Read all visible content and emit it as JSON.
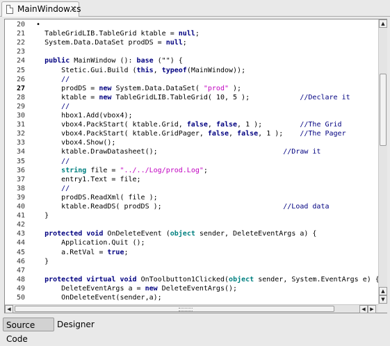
{
  "window": {
    "tab_title": "MainWindow.cs",
    "close_glyph": "✕",
    "icons": [
      "document-icon",
      "close-icon"
    ]
  },
  "editor": {
    "line_numbers": [
      "20",
      "21",
      "22",
      "23",
      "24",
      "25",
      "26",
      "27",
      "28",
      "29",
      "30",
      "31",
      "32",
      "33",
      "34",
      "35",
      "36",
      "37",
      "38",
      "39",
      "40",
      "41",
      "42",
      "43",
      "44",
      "45",
      "46",
      "47",
      "48",
      "49",
      "50"
    ],
    "current_line": "27",
    "lines": [
      [
        [
          "t",
          "  •"
        ]
      ],
      [
        [
          "t",
          "    TableGridLIB.TableGrid ktable = "
        ],
        [
          "k",
          "null"
        ],
        [
          "t",
          ";"
        ]
      ],
      [
        [
          "t",
          "    System.Data.DataSet prodDS = "
        ],
        [
          "k",
          "null"
        ],
        [
          "t",
          ";"
        ]
      ],
      [],
      [
        [
          "t",
          "    "
        ],
        [
          "k",
          "public"
        ],
        [
          "t",
          " MainWindow (): "
        ],
        [
          "k",
          "base"
        ],
        [
          "t",
          " (\"\") {"
        ]
      ],
      [
        [
          "t",
          "        Stetic.Gui.Build ("
        ],
        [
          "k",
          "this"
        ],
        [
          "t",
          ", "
        ],
        [
          "k",
          "typeof"
        ],
        [
          "t",
          "(MainWindow));"
        ]
      ],
      [
        [
          "c",
          "        //"
        ]
      ],
      [
        [
          "t",
          "        prodDS = "
        ],
        [
          "k",
          "new"
        ],
        [
          "t",
          " System.Data.DataSet( "
        ],
        [
          "s",
          "\"prod\""
        ],
        [
          "t",
          " );"
        ]
      ],
      [
        [
          "t",
          "        ktable = "
        ],
        [
          "k",
          "new"
        ],
        [
          "t",
          " TableGridLIB.TableGrid( 10, 5 );            "
        ],
        [
          "c",
          "//Declare it"
        ]
      ],
      [
        [
          "c",
          "        //"
        ]
      ],
      [
        [
          "t",
          "        hbox1.Add(vbox4);"
        ]
      ],
      [
        [
          "t",
          "        vbox4.PackStart( ktable.Grid, "
        ],
        [
          "k",
          "false"
        ],
        [
          "t",
          ", "
        ],
        [
          "k",
          "false"
        ],
        [
          "t",
          ", 1 );         "
        ],
        [
          "c",
          "//The Grid"
        ]
      ],
      [
        [
          "t",
          "        vbox4.PackStart( ktable.GridPager, "
        ],
        [
          "k",
          "false"
        ],
        [
          "t",
          ", "
        ],
        [
          "k",
          "false"
        ],
        [
          "t",
          ", 1 );    "
        ],
        [
          "c",
          "//The Pager"
        ]
      ],
      [
        [
          "t",
          "        vbox4.Show();"
        ]
      ],
      [
        [
          "t",
          "        ktable.DrawDatasheet();                              "
        ],
        [
          "c",
          "//Draw it"
        ]
      ],
      [
        [
          "c",
          "        //"
        ]
      ],
      [
        [
          "t",
          "        "
        ],
        [
          "y",
          "string"
        ],
        [
          "t",
          " file = "
        ],
        [
          "s",
          "\"../../Log/prod.Log\""
        ],
        [
          "t",
          ";"
        ]
      ],
      [
        [
          "t",
          "        entry1.Text = file;"
        ]
      ],
      [
        [
          "c",
          "        //"
        ]
      ],
      [
        [
          "t",
          "        prodDS.ReadXml( file );"
        ]
      ],
      [
        [
          "t",
          "        ktable.ReadDS( prodDS );                             "
        ],
        [
          "c",
          "//Load data"
        ]
      ],
      [
        [
          "t",
          "    }"
        ]
      ],
      [],
      [
        [
          "t",
          "    "
        ],
        [
          "k",
          "protected"
        ],
        [
          "t",
          " "
        ],
        [
          "k",
          "void"
        ],
        [
          "t",
          " OnDeleteEvent ("
        ],
        [
          "y",
          "object"
        ],
        [
          "t",
          " sender, DeleteEventArgs a) {"
        ]
      ],
      [
        [
          "t",
          "        Application.Quit ();"
        ]
      ],
      [
        [
          "t",
          "        a.RetVal = "
        ],
        [
          "k",
          "true"
        ],
        [
          "t",
          ";"
        ]
      ],
      [
        [
          "t",
          "    }"
        ]
      ],
      [],
      [
        [
          "t",
          "    "
        ],
        [
          "k",
          "protected"
        ],
        [
          "t",
          " "
        ],
        [
          "k",
          "virtual"
        ],
        [
          "t",
          " "
        ],
        [
          "k",
          "void"
        ],
        [
          "t",
          " OnToolbutton1Clicked("
        ],
        [
          "y",
          "object"
        ],
        [
          "t",
          " sender, System.EventArgs e) {"
        ]
      ],
      [
        [
          "t",
          "        DeleteEventArgs a = "
        ],
        [
          "k",
          "new"
        ],
        [
          "t",
          " DeleteEventArgs();"
        ]
      ],
      [
        [
          "t",
          "        OnDeleteEvent(sender,a);"
        ]
      ]
    ]
  },
  "scrollbars": {
    "up_glyph": "▲",
    "down_glyph": "▼",
    "left_glyph": "◀",
    "right_glyph": "▶"
  },
  "bottom_tabs": {
    "source_code": "Source Code",
    "designer": "Designer"
  }
}
